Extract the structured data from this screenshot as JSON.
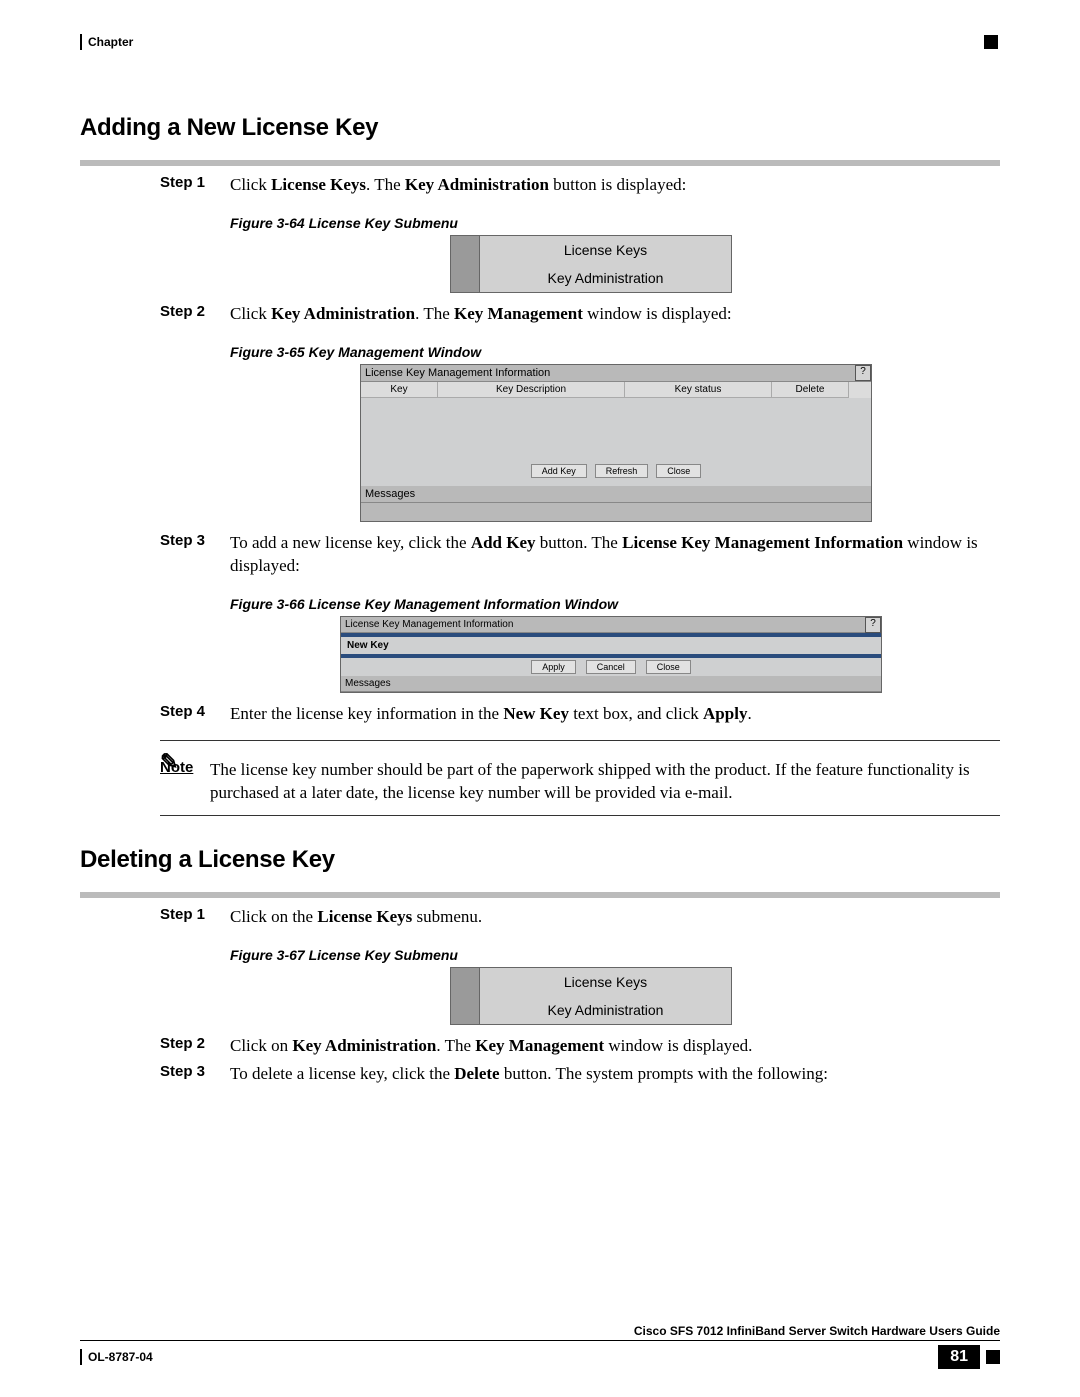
{
  "header": {
    "chapter": "Chapter"
  },
  "section1": {
    "title": "Adding a New License Key",
    "step1": {
      "label": "Step 1",
      "text_before": "Click ",
      "bold1": "License Keys",
      "text_mid": ". The ",
      "bold2": "Key Administration",
      "text_after": " button is displayed:"
    },
    "fig64": {
      "caption": "Figure 3-64   License Key Submenu",
      "row1": "License Keys",
      "row2": "Key Administration"
    },
    "step2": {
      "label": "Step 2",
      "text_before": "Click ",
      "bold1": "Key Administration",
      "text_mid": ". The ",
      "bold2": "Key Management",
      "text_after": " window is displayed:"
    },
    "fig65": {
      "caption": "Figure 3-65   Key Management Window",
      "title": "License Key Management Information",
      "col1": "Key",
      "col2": "Key Description",
      "col3": "Key status",
      "col4": "Delete",
      "btn1": "Add Key",
      "btn2": "Refresh",
      "btn3": "Close",
      "messages": "Messages",
      "help": "?"
    },
    "step3": {
      "label": "Step 3",
      "text_before": "To add a new license key, click the ",
      "bold1": "Add Key",
      "text_mid": " button. The ",
      "bold2": "License Key Management Information",
      "text_after": " window is displayed:"
    },
    "fig66": {
      "caption": "Figure 3-66   License Key Management Information Window",
      "title": "License Key Management Information",
      "newkey": "New Key",
      "btn1": "Apply",
      "btn2": "Cancel",
      "btn3": "Close",
      "messages": "Messages",
      "help": "?"
    },
    "step4": {
      "label": "Step 4",
      "text_before": "Enter the license key information in the ",
      "bold1": "New Key",
      "text_mid": " text box, and click ",
      "bold2": "Apply",
      "text_after": "."
    },
    "note": {
      "label": "Note",
      "text": "The license key number should be part of the paperwork shipped with the product. If the feature functionality is purchased at a later date, the license key number will be provided via e-mail."
    }
  },
  "section2": {
    "title": "Deleting a License Key",
    "step1": {
      "label": "Step 1",
      "text_before": "Click on the ",
      "bold1": "License Keys",
      "text_after": " submenu."
    },
    "fig67": {
      "caption": "Figure 3-67   License Key Submenu",
      "row1": "License Keys",
      "row2": "Key Administration"
    },
    "step2": {
      "label": "Step 2",
      "text_before": "Click on ",
      "bold1": "Key Administration",
      "text_mid": ". The ",
      "bold2": "Key Management",
      "text_after": " window is displayed."
    },
    "step3": {
      "label": "Step 3",
      "text_before": "To delete a license key, click the ",
      "bold1": "Delete",
      "text_after": " button. The system prompts with the following:"
    }
  },
  "footer": {
    "guide": "Cisco SFS 7012 InfiniBand Server Switch Hardware Users Guide",
    "docnum": "OL-8787-04",
    "pageno": "81"
  }
}
